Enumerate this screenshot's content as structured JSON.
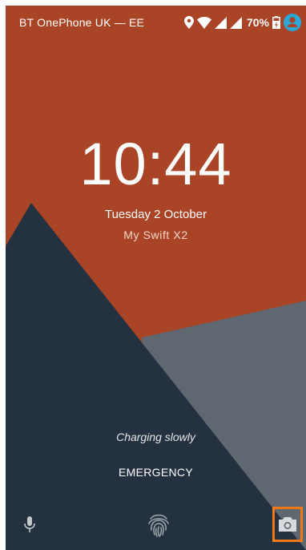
{
  "status_bar": {
    "carrier": "BT OnePhone UK — EE",
    "battery_percent": "70%",
    "icons": [
      "location-pin-icon",
      "wifi-icon",
      "cell-signal-icon",
      "cell-signal-icon",
      "battery-icon",
      "account-icon"
    ]
  },
  "lockscreen": {
    "time": "10:44",
    "date": "Tuesday 2 October",
    "owner_info": "My Swift X2",
    "charging_status": "Charging slowly",
    "emergency_label": "EMERGENCY"
  },
  "bottom_shortcuts": [
    "mic-icon",
    "fingerprint-icon",
    "camera-icon"
  ],
  "colors": {
    "wallpaper_orange": "#a94426",
    "wallpaper_navy": "#243141",
    "wallpaper_grey": "#5f6870",
    "account_icon": "#2aa8d8",
    "camera_highlight": "#f07a1a"
  }
}
